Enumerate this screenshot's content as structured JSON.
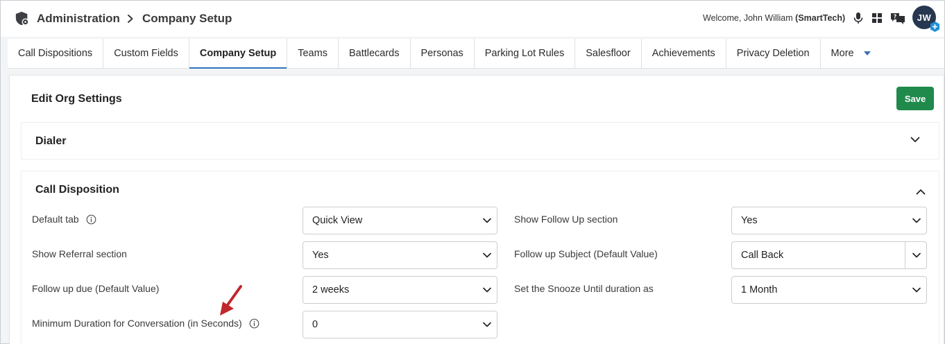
{
  "header": {
    "breadcrumb_root": "Administration",
    "breadcrumb_current": "Company Setup",
    "welcome_prefix": "Welcome, John William",
    "welcome_org": "(SmartTech)",
    "avatar_initials": "JW",
    "icons": [
      "admin-shield-icon",
      "chevron-right-icon",
      "microphone-icon",
      "apps-grid-icon",
      "chat-help-icon"
    ]
  },
  "tabs": [
    {
      "label": "Call Dispositions"
    },
    {
      "label": "Custom Fields"
    },
    {
      "label": "Company Setup",
      "active": true
    },
    {
      "label": "Teams"
    },
    {
      "label": "Battlecards"
    },
    {
      "label": "Personas"
    },
    {
      "label": "Parking Lot Rules"
    },
    {
      "label": "Salesfloor"
    },
    {
      "label": "Achievements"
    },
    {
      "label": "Privacy Deletion"
    },
    {
      "label": "More"
    }
  ],
  "panel": {
    "title": "Edit Org Settings",
    "save_label": "Save"
  },
  "sections": {
    "dialer": {
      "title": "Dialer",
      "expanded": false
    },
    "call_disposition": {
      "title": "Call Disposition",
      "expanded": true,
      "fields": {
        "default_tab": {
          "label": "Default tab",
          "value": "Quick View"
        },
        "show_referral": {
          "label": "Show Referral section",
          "value": "Yes"
        },
        "follow_up_due": {
          "label": "Follow up due (Default Value)",
          "value": "2 weeks"
        },
        "min_duration": {
          "label": "Minimum Duration for Conversation (in Seconds)",
          "value": "0"
        },
        "show_follow_up": {
          "label": "Show Follow Up section",
          "value": "Yes"
        },
        "follow_up_subject": {
          "label": "Follow up Subject (Default Value)",
          "value": "Call Back"
        },
        "snooze_until": {
          "label": "Set the Snooze Until duration as",
          "value": "1 Month"
        }
      }
    }
  },
  "colors": {
    "save_button": "#1f8a4c",
    "active_tab_underline": "#2f74c0",
    "avatar_bg": "#26374f",
    "annotation_arrow": "#c0282d"
  }
}
